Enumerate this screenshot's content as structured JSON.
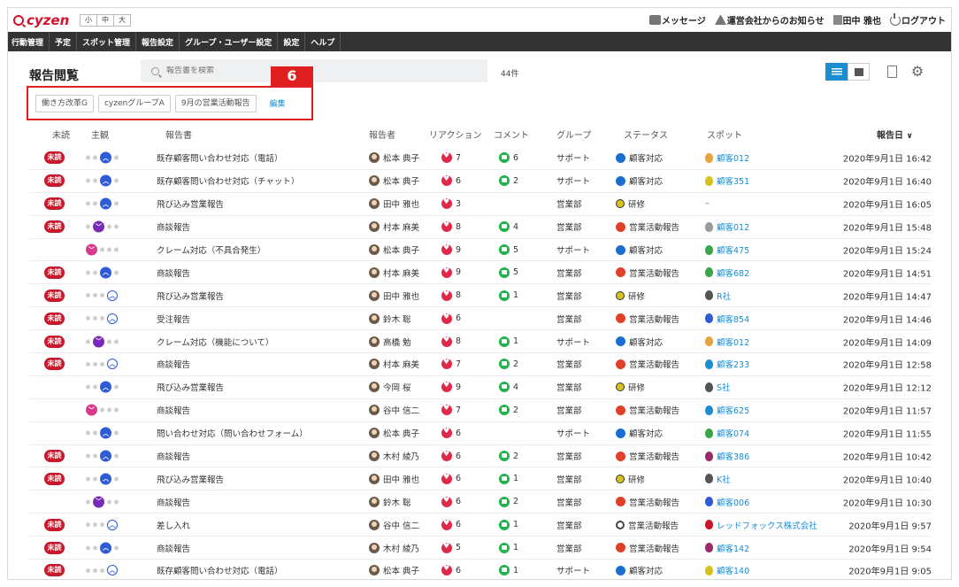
{
  "header": {
    "logo": "cyzen",
    "font_sizes": [
      "小",
      "中",
      "大"
    ],
    "messages": "メッセージ",
    "announcements": "運営会社からのお知らせ",
    "user_name": "田中 雅也",
    "logout": "ログアウト"
  },
  "nav": [
    "行動管理",
    "予定",
    "スポット管理",
    "報告設定",
    "グループ・ユーザー設定",
    "設定",
    "ヘルプ"
  ],
  "page": {
    "title": "報告閲覧",
    "search_placeholder": "報告書を検索",
    "count": "44件",
    "step_badge": "6"
  },
  "tags": [
    "働き方改革G",
    "cyzenグループA",
    "9月の営業活動報告"
  ],
  "tag_edit": "編集",
  "columns": {
    "unread": "未読",
    "subjective": "主観",
    "report": "報告書",
    "reporter": "報告者",
    "reaction": "リアクション",
    "comment": "コメント",
    "group": "グループ",
    "status": "ステータス",
    "spot": "スポット",
    "date": "報告日",
    "sort_icon": "chevron-down-icon"
  },
  "unread_label": "未読",
  "colors": {
    "nav_bg": "#333333",
    "accent_blue": "#1a8ed0",
    "unread_red": "#c8192c",
    "highlight_red": "#e02020"
  },
  "rows": [
    {
      "unread": true,
      "mood": "up",
      "title": "既存顧客問い合わせ対応（電話）",
      "reporter": "松本 典子",
      "reactions": "7",
      "comments": "6",
      "group": "サポート",
      "status": "顧客対応",
      "status_type": "customer",
      "spot": "顧客012",
      "spot_color": "#e8a33a",
      "date": "2020年9月1日 16:42"
    },
    {
      "unread": true,
      "mood": "up",
      "title": "既存顧客問い合わせ対応（チャット）",
      "reporter": "松本 典子",
      "reactions": "6",
      "comments": "2",
      "group": "サポート",
      "status": "顧客対応",
      "status_type": "customer",
      "spot": "顧客351",
      "spot_color": "#d6c21a",
      "date": "2020年9月1日 16:40"
    },
    {
      "unread": true,
      "mood": "up",
      "title": "飛び込み営業報告",
      "reporter": "田中 雅也",
      "reactions": "3",
      "comments": "",
      "group": "営業部",
      "status": "研修",
      "status_type": "training",
      "spot": "–",
      "spot_color": "",
      "date": "2020年9月1日 16:05"
    },
    {
      "unread": true,
      "mood": "down",
      "title": "商談報告",
      "reporter": "村本 麻美",
      "reactions": "8",
      "comments": "4",
      "group": "営業部",
      "status": "営業活動報告",
      "status_type": "sales",
      "spot": "顧客012",
      "spot_color": "#9a9a9a",
      "date": "2020年9月1日 15:48"
    },
    {
      "unread": false,
      "mood": "pink",
      "title": "クレーム対応（不具合発生）",
      "reporter": "松本 典子",
      "reactions": "9",
      "comments": "5",
      "group": "サポート",
      "status": "顧客対応",
      "status_type": "customer",
      "spot": "顧客475",
      "spot_color": "#3aa64a",
      "date": "2020年9月1日 15:24"
    },
    {
      "unread": true,
      "mood": "up",
      "title": "商談報告",
      "reporter": "村本 麻美",
      "reactions": "9",
      "comments": "5",
      "group": "営業部",
      "status": "営業活動報告",
      "status_type": "sales",
      "spot": "顧客682",
      "spot_color": "#3aa64a",
      "date": "2020年9月1日 14:51"
    },
    {
      "unread": true,
      "mood": "out",
      "title": "飛び込み営業報告",
      "reporter": "田中 雅也",
      "reactions": "8",
      "comments": "1",
      "group": "営業部",
      "status": "研修",
      "status_type": "training",
      "spot": "R社",
      "spot_color": "#555555",
      "date": "2020年9月1日 14:47"
    },
    {
      "unread": true,
      "mood": "out",
      "title": "受注報告",
      "reporter": "鈴木 聡",
      "reactions": "6",
      "comments": "",
      "group": "営業部",
      "status": "営業活動報告",
      "status_type": "sales",
      "spot": "顧客854",
      "spot_color": "#2e5bd6",
      "date": "2020年9月1日 14:46"
    },
    {
      "unread": true,
      "mood": "down",
      "title": "クレーム対応（機能について）",
      "reporter": "高橋 勉",
      "reactions": "8",
      "comments": "1",
      "group": "サポート",
      "status": "顧客対応",
      "status_type": "customer",
      "spot": "顧客012",
      "spot_color": "#e8a33a",
      "date": "2020年9月1日 14:09"
    },
    {
      "unread": true,
      "mood": "out",
      "title": "商談報告",
      "reporter": "村本 麻美",
      "reactions": "7",
      "comments": "2",
      "group": "営業部",
      "status": "営業活動報告",
      "status_type": "sales",
      "spot": "顧客233",
      "spot_color": "#1a8ed0",
      "date": "2020年9月1日 12:58"
    },
    {
      "unread": false,
      "mood": "up",
      "title": "飛び込み営業報告",
      "reporter": "今岡 桜",
      "reactions": "9",
      "comments": "4",
      "group": "営業部",
      "status": "研修",
      "status_type": "training",
      "spot": "S社",
      "spot_color": "#555555",
      "date": "2020年9月1日 12:12"
    },
    {
      "unread": false,
      "mood": "pink",
      "title": "商談報告",
      "reporter": "谷中 信二",
      "reactions": "7",
      "comments": "2",
      "group": "営業部",
      "status": "営業活動報告",
      "status_type": "sales",
      "spot": "顧客625",
      "spot_color": "#1a8ed0",
      "date": "2020年9月1日 11:57"
    },
    {
      "unread": false,
      "mood": "up",
      "title": "問い合わせ対応（問い合わせフォーム）",
      "reporter": "松本 典子",
      "reactions": "6",
      "comments": "",
      "group": "サポート",
      "status": "顧客対応",
      "status_type": "customer",
      "spot": "顧客074",
      "spot_color": "#3aa64a",
      "date": "2020年9月1日 11:55"
    },
    {
      "unread": true,
      "mood": "up",
      "title": "商談報告",
      "reporter": "木村 綾乃",
      "reactions": "6",
      "comments": "2",
      "group": "営業部",
      "status": "営業活動報告",
      "status_type": "sales",
      "spot": "顧客386",
      "spot_color": "#9a2a6a",
      "date": "2020年9月1日 10:42"
    },
    {
      "unread": true,
      "mood": "up",
      "title": "飛び込み営業報告",
      "reporter": "田中 雅也",
      "reactions": "6",
      "comments": "1",
      "group": "営業部",
      "status": "研修",
      "status_type": "training",
      "spot": "K社",
      "spot_color": "#555555",
      "date": "2020年9月1日 10:40"
    },
    {
      "unread": false,
      "mood": "down",
      "title": "商談報告",
      "reporter": "鈴木 聡",
      "reactions": "6",
      "comments": "2",
      "group": "営業部",
      "status": "営業活動報告",
      "status_type": "sales",
      "spot": "顧客006",
      "spot_color": "#2e5bd6",
      "date": "2020年9月1日 10:30"
    },
    {
      "unread": true,
      "mood": "out",
      "title": "差し入れ",
      "reporter": "谷中 信二",
      "reactions": "6",
      "comments": "1",
      "group": "営業部",
      "status": "営業活動報告",
      "status_type": "sales2",
      "spot": "レッドフォックス株式会社",
      "spot_color": "#d0132a",
      "date": "2020年9月1日 9:57"
    },
    {
      "unread": true,
      "mood": "up",
      "title": "商談報告",
      "reporter": "木村 綾乃",
      "reactions": "5",
      "comments": "1",
      "group": "営業部",
      "status": "営業活動報告",
      "status_type": "sales",
      "spot": "顧客142",
      "spot_color": "#9a2a6a",
      "date": "2020年9月1日 9:54"
    },
    {
      "unread": true,
      "mood": "out",
      "title": "既存顧客問い合わせ対応（電話）",
      "reporter": "松本 典子",
      "reactions": "6",
      "comments": "1",
      "group": "サポート",
      "status": "顧客対応",
      "status_type": "customer",
      "spot": "顧客140",
      "spot_color": "#d6c21a",
      "date": "2020年9月1日 9:05"
    }
  ]
}
